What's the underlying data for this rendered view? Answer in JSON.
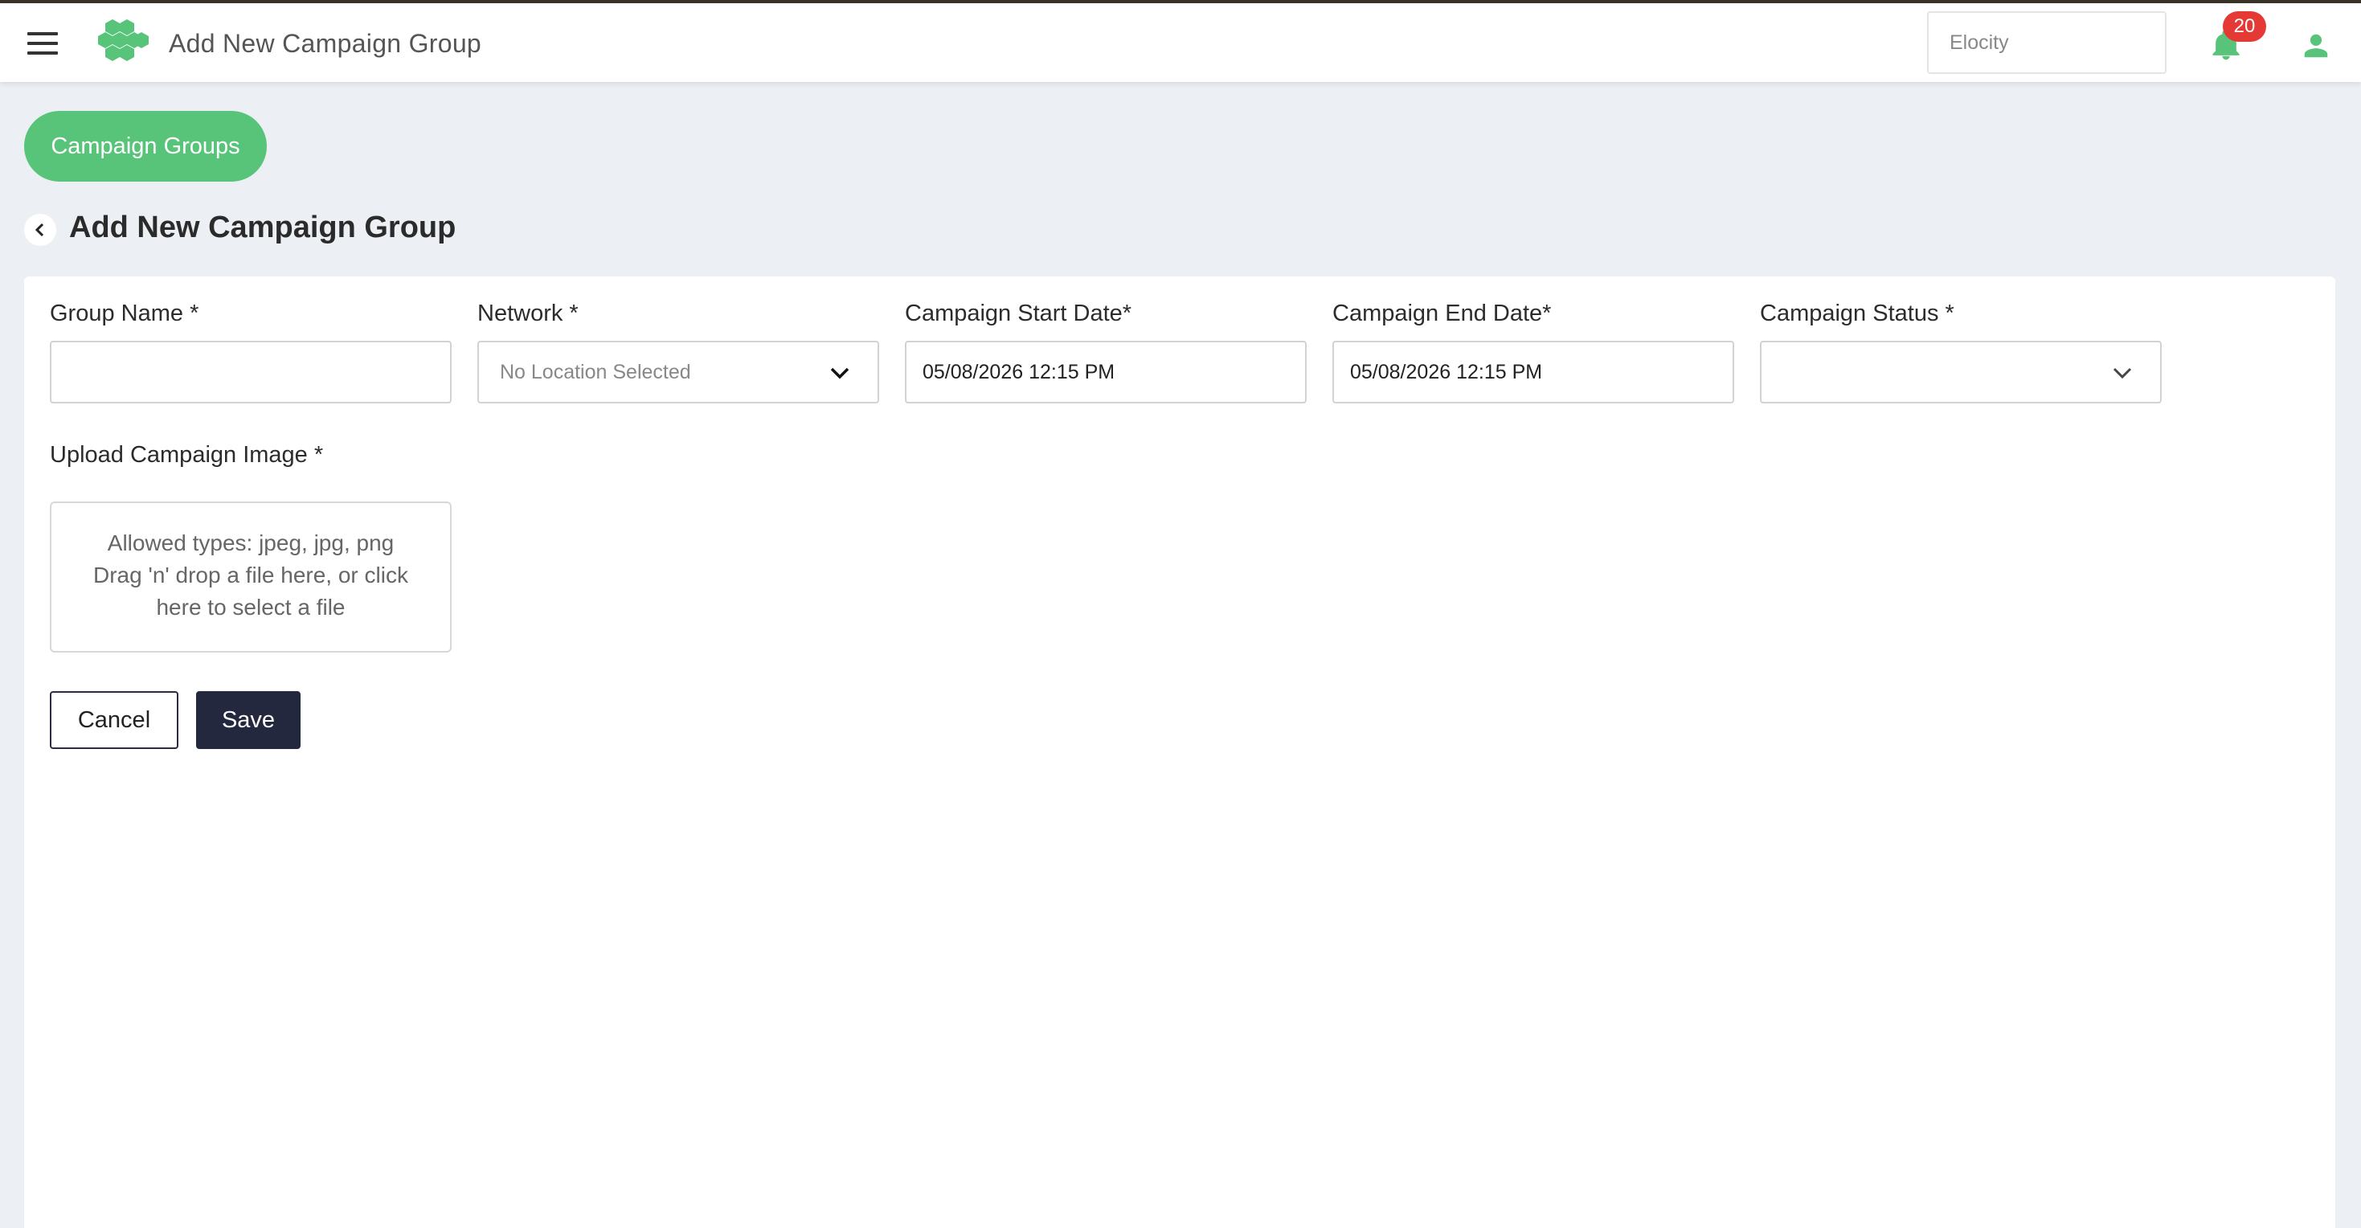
{
  "app": {
    "title": "Add New Campaign Group",
    "org_selector": "Elocity",
    "notification_count": "20",
    "brand_color": "#58c47a"
  },
  "breadcrumb": {
    "campaign_groups": "Campaign Groups"
  },
  "page": {
    "title": "Add New Campaign Group"
  },
  "form": {
    "group_name": {
      "label": "Group Name *",
      "value": ""
    },
    "network": {
      "label": "Network *",
      "value": "No Location Selected"
    },
    "start_date": {
      "label": "Campaign Start Date*",
      "value": "05/08/2026 12:15 PM"
    },
    "end_date": {
      "label": "Campaign End Date*",
      "value": "05/08/2026 12:15 PM"
    },
    "status": {
      "label": "Campaign Status *",
      "value": ""
    },
    "upload": {
      "label": "Upload Campaign Image *",
      "line1": "Allowed types: jpeg, jpg, png",
      "line2": "Drag 'n' drop a file here, or click",
      "line3": "here to select a file"
    }
  },
  "actions": {
    "cancel": "Cancel",
    "save": "Save"
  },
  "icons": [
    "menu-icon",
    "logo-icon",
    "bell-icon",
    "user-icon",
    "back-chevron-icon",
    "chevron-down-icon"
  ]
}
